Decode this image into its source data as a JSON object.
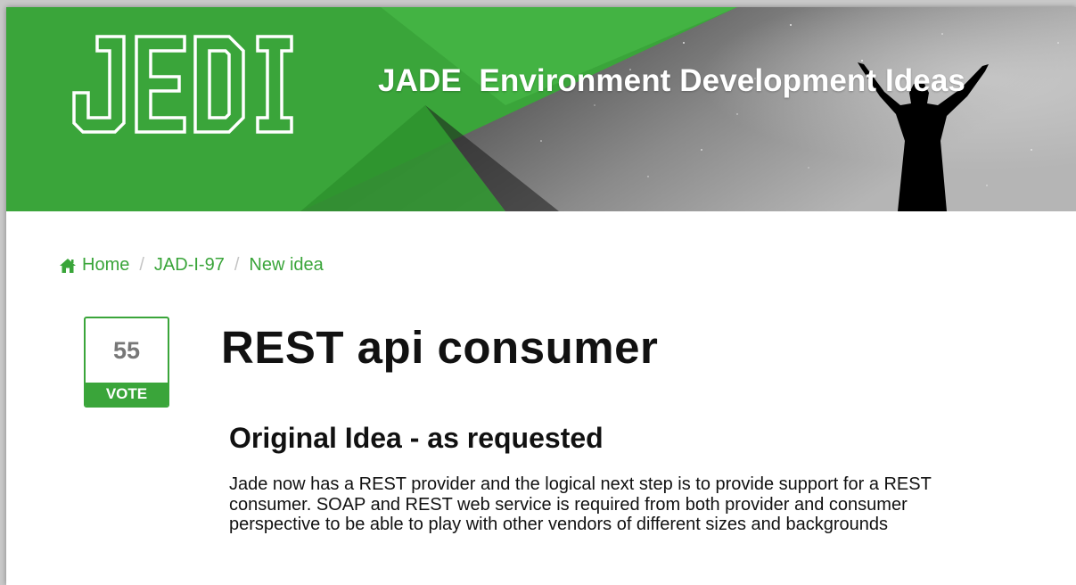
{
  "banner": {
    "tagline": "JADE  Environment Development Ideas",
    "colors": {
      "green": "#3aa53a",
      "dark_green": "#2d8f2d"
    }
  },
  "breadcrumb": {
    "items": [
      {
        "label": "Home",
        "icon": "home-icon"
      },
      {
        "label": "JAD-I-97"
      },
      {
        "label": "New idea"
      }
    ],
    "separator": "/"
  },
  "vote": {
    "count": "55",
    "label": "VOTE"
  },
  "idea": {
    "title": "REST api consumer",
    "section_heading": "Original Idea - as requested",
    "description": "Jade now has a REST provider and the logical next step is to provide support for a REST consumer. SOAP and REST web service is required from both provider and consumer perspective to be able to play with other vendors of different sizes and backgrounds"
  }
}
